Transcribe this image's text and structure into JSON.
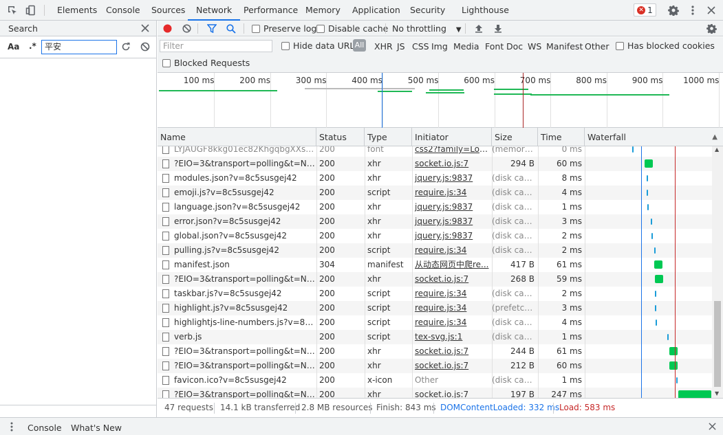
{
  "toolbar": {
    "tabs": [
      "Elements",
      "Console",
      "Sources",
      "Network",
      "Performance",
      "Memory",
      "Application",
      "Security",
      "Lighthouse"
    ],
    "active_tab": "Network",
    "error_count": "1"
  },
  "search_panel": {
    "title": "Search",
    "case_label": "Aa",
    "regex_label": ".*",
    "query": "平安"
  },
  "network_toolbar": {
    "preserve_log": "Preserve log",
    "disable_cache": "Disable cache",
    "throttling": "No throttling"
  },
  "filter_bar": {
    "placeholder": "Filter",
    "hide_data_urls": "Hide data URLs",
    "types": [
      "All",
      "XHR",
      "JS",
      "CSS",
      "Img",
      "Media",
      "Font",
      "Doc",
      "WS",
      "Manifest",
      "Other"
    ],
    "has_blocked_cookies": "Has blocked cookies",
    "blocked_requests": "Blocked Requests"
  },
  "overview": {
    "ticks": [
      "100 ms",
      "200 ms",
      "300 ms",
      "400 ms",
      "500 ms",
      "600 ms",
      "700 ms",
      "800 ms",
      "900 ms",
      "1000 ms"
    ]
  },
  "table": {
    "columns": [
      "Name",
      "Status",
      "Type",
      "Initiator",
      "Size",
      "Time",
      "Waterfall"
    ],
    "rows": [
      {
        "name": "LYJAUGF8kkg01ec82KhgqbgXXsWsM...",
        "status": "200",
        "type": "font",
        "initiator": "css2?family=Long...",
        "size": "(memory...",
        "time": "0 ms",
        "partial": true
      },
      {
        "name": "?EIO=3&transport=polling&t=NZGX...",
        "status": "200",
        "type": "xhr",
        "initiator": "socket.io.js:7",
        "size": "294 B",
        "time": "60 ms"
      },
      {
        "name": "modules.json?v=8c5susgej42",
        "status": "200",
        "type": "xhr",
        "initiator": "jquery.js:9837",
        "size": "(disk cac...",
        "time": "8 ms"
      },
      {
        "name": "emoji.js?v=8c5susgej42",
        "status": "200",
        "type": "script",
        "initiator": "require.js:34",
        "size": "(disk cac...",
        "time": "4 ms"
      },
      {
        "name": "language.json?v=8c5susgej42",
        "status": "200",
        "type": "xhr",
        "initiator": "jquery.js:9837",
        "size": "(disk cac...",
        "time": "1 ms"
      },
      {
        "name": "error.json?v=8c5susgej42",
        "status": "200",
        "type": "xhr",
        "initiator": "jquery.js:9837",
        "size": "(disk cac...",
        "time": "3 ms"
      },
      {
        "name": "global.json?v=8c5susgej42",
        "status": "200",
        "type": "xhr",
        "initiator": "jquery.js:9837",
        "size": "(disk cac...",
        "time": "2 ms"
      },
      {
        "name": "pulling.js?v=8c5susgej42",
        "status": "200",
        "type": "script",
        "initiator": "require.js:34",
        "size": "(disk cac...",
        "time": "2 ms"
      },
      {
        "name": "manifest.json",
        "status": "304",
        "type": "manifest",
        "initiator": "从动态网页中爬re...",
        "size": "417 B",
        "time": "61 ms"
      },
      {
        "name": "?EIO=3&transport=polling&t=NZGX...",
        "status": "200",
        "type": "xhr",
        "initiator": "socket.io.js:7",
        "size": "268 B",
        "time": "59 ms"
      },
      {
        "name": "taskbar.js?v=8c5susgej42",
        "status": "200",
        "type": "script",
        "initiator": "require.js:34",
        "size": "(disk cac...",
        "time": "2 ms"
      },
      {
        "name": "highlight.js?v=8c5susgej42",
        "status": "200",
        "type": "script",
        "initiator": "require.js:34",
        "size": "(prefetch...",
        "time": "3 ms"
      },
      {
        "name": "highlightjs-line-numbers.js?v=8c5su...",
        "status": "200",
        "type": "script",
        "initiator": "require.js:34",
        "size": "(disk cac...",
        "time": "4 ms"
      },
      {
        "name": "verb.js",
        "status": "200",
        "type": "script",
        "initiator": "tex-svg.js:1",
        "size": "(disk cac...",
        "time": "1 ms"
      },
      {
        "name": "?EIO=3&transport=polling&t=NZGX...",
        "status": "200",
        "type": "xhr",
        "initiator": "socket.io.js:7",
        "size": "244 B",
        "time": "61 ms"
      },
      {
        "name": "?EIO=3&transport=polling&t=NZGX...",
        "status": "200",
        "type": "xhr",
        "initiator": "socket.io.js:7",
        "size": "212 B",
        "time": "60 ms"
      },
      {
        "name": "favicon.ico?v=8c5susgej42",
        "status": "200",
        "type": "x-icon",
        "initiator": "Other",
        "size": "(disk cac...",
        "time": "1 ms"
      },
      {
        "name": "?EIO=3&transport=polling&t=NZGX...",
        "status": "200",
        "type": "xhr",
        "initiator": "socket.io.js:7",
        "size": "197 B",
        "time": "247 ms"
      }
    ]
  },
  "status_bar": {
    "requests": "47 requests",
    "transferred": "14.1 kB transferred",
    "resources": "2.8 MB resources",
    "finish": "Finish: 843 ms",
    "dom_content_loaded": "DOMContentLoaded: 332 ms",
    "load": "Load: 583 ms"
  },
  "drawer": {
    "tabs": [
      "Console",
      "What's New"
    ]
  },
  "colors": {
    "accent": "#1a73e8",
    "waiting": "#00c853",
    "queued": "#1a9cd8",
    "dcl_line": "#1a73e8",
    "load_line": "#c62828",
    "record": "#e52a2a"
  }
}
